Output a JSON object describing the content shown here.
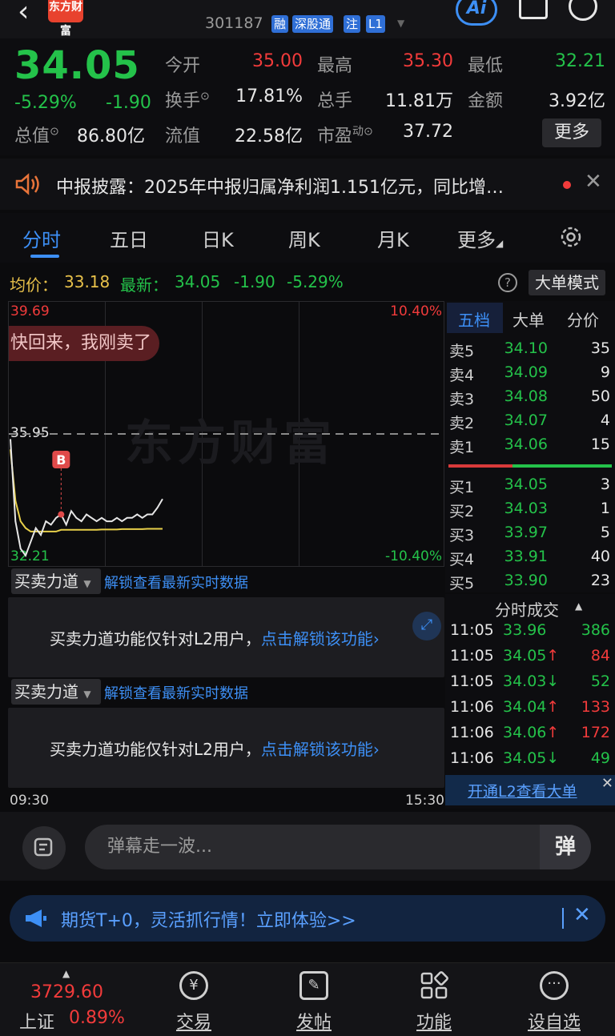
{
  "header": {
    "logo_text": "东方财富",
    "stock_code": "301187",
    "tags": [
      "融",
      "深股通",
      "注",
      "L1"
    ],
    "ai_label": "Ai"
  },
  "quote": {
    "price": "34.05",
    "change_pct": "-5.29%",
    "change": "-1.90",
    "rows": [
      {
        "l1": "今开",
        "v1": "35.00",
        "l2": "最高",
        "v2": "35.30",
        "l3": "最低",
        "v3": "32.21"
      },
      {
        "l1": "换手",
        "v1": "17.81%",
        "l2": "总手",
        "v2": "11.81万",
        "l3": "金额",
        "v3": "3.92亿"
      },
      {
        "l1": "流值",
        "v1": "22.58亿",
        "l2": "市盈",
        "v2": "37.72"
      }
    ],
    "market_cap_label": "总值",
    "market_cap": "86.80亿",
    "pe_suffix": "动",
    "more": "更多"
  },
  "notice": {
    "text": "中报披露：2025年中报归属净利润1.151亿元，同比增…"
  },
  "tabs": [
    "分时",
    "五日",
    "日K",
    "周K",
    "月K",
    "更多"
  ],
  "avg_bar": {
    "avg_label": "均价：",
    "avg_value": "33.18",
    "latest_label": "最新：",
    "latest_value": "34.05",
    "change": "-1.90",
    "change_pct": "-5.29%",
    "big_order_btn": "大单模式"
  },
  "chart": {
    "top_price": "39.69",
    "top_pct": "10.40%",
    "mid_price": "35.95",
    "bottom_price": "32.21",
    "bottom_pct": "-10.40%",
    "watermark": "东方财富",
    "bubble": "快回来，我刚卖了",
    "marker": "B",
    "time_start": "09:30",
    "time_end": "15:30",
    "price_line": [
      35.8,
      33.4,
      32.6,
      32.4,
      32.8,
      33.2,
      33.0,
      33.4,
      33.3,
      33.5,
      33.6,
      33.3,
      33.7,
      33.5,
      33.4,
      33.6,
      33.5,
      33.4,
      33.5,
      33.4,
      33.4,
      33.5,
      33.4,
      33.5,
      33.5,
      33.6,
      33.5,
      33.6,
      33.6,
      33.8,
      34.05
    ],
    "avg_line": [
      35.5,
      34.0,
      33.4,
      33.2,
      33.1,
      33.1,
      33.1,
      33.1,
      33.1,
      33.1,
      33.15,
      33.15,
      33.15,
      33.15,
      33.15,
      33.15,
      33.15,
      33.15,
      33.16,
      33.16,
      33.16,
      33.16,
      33.17,
      33.17,
      33.17,
      33.17,
      33.17,
      33.18,
      33.18,
      33.18,
      33.18
    ]
  },
  "book": {
    "tabs": [
      "五档",
      "大单",
      "分价"
    ],
    "asks": [
      {
        "label": "卖5",
        "price": "34.10",
        "vol": "35"
      },
      {
        "label": "卖4",
        "price": "34.09",
        "vol": "9"
      },
      {
        "label": "卖3",
        "price": "34.08",
        "vol": "50"
      },
      {
        "label": "卖2",
        "price": "34.07",
        "vol": "4"
      },
      {
        "label": "卖1",
        "price": "34.06",
        "vol": "15"
      }
    ],
    "bids": [
      {
        "label": "买1",
        "price": "34.05",
        "vol": "3"
      },
      {
        "label": "买2",
        "price": "34.03",
        "vol": "1"
      },
      {
        "label": "买3",
        "price": "33.97",
        "vol": "5"
      },
      {
        "label": "买4",
        "price": "33.91",
        "vol": "40"
      },
      {
        "label": "买5",
        "price": "33.90",
        "vol": "23"
      }
    ]
  },
  "force": {
    "select_label": "买卖力道",
    "unlock_link": "解锁查看最新实时数据",
    "msg_prefix": "买卖力道功能仅针对L2用户，",
    "msg_link": "点击解锁该功能"
  },
  "ticks": {
    "title": "分时成交",
    "rows": [
      {
        "time": "11:05",
        "price": "33.96",
        "vol": "386",
        "dir": ""
      },
      {
        "time": "11:05",
        "price": "34.05",
        "vol": "84",
        "dir": "↑"
      },
      {
        "time": "11:05",
        "price": "34.03",
        "vol": "52",
        "dir": "↓"
      },
      {
        "time": "11:06",
        "price": "34.04",
        "vol": "133",
        "dir": "↑"
      },
      {
        "time": "11:06",
        "price": "34.06",
        "vol": "172",
        "dir": "↑"
      },
      {
        "time": "11:06",
        "price": "34.05",
        "vol": "49",
        "dir": "↓"
      }
    ],
    "l2_banner": "开通L2查看大单"
  },
  "danmu": {
    "placeholder": "弹幕走一波...",
    "send": "弹"
  },
  "promo": {
    "text": "期货T+0，灵活抓行情！立即体验>>"
  },
  "nav": {
    "index_value": "3729.60",
    "index_name": "上证",
    "index_pct": "0.89%",
    "items": [
      "交易",
      "发帖",
      "功能",
      "设自选"
    ]
  },
  "colors": {
    "down": "#24c24a",
    "up": "#f23b3b",
    "accent": "#3d8ff5"
  }
}
